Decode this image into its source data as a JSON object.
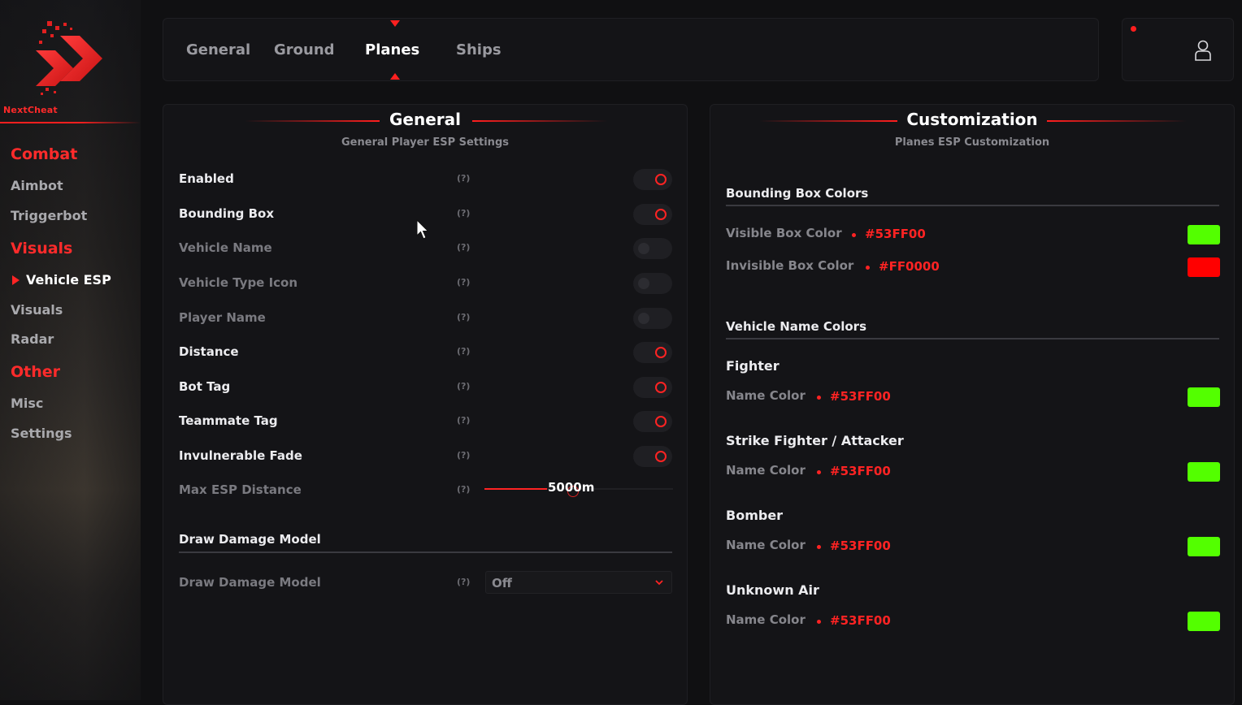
{
  "brand": {
    "name": "NextCheat",
    "accent_color": "#ff2323"
  },
  "sidebar": {
    "categories": [
      {
        "label": "Combat",
        "items": [
          "Aimbot",
          "Triggerbot"
        ]
      },
      {
        "label": "Visuals",
        "items": [
          "Vehicle ESP",
          "Visuals",
          "Radar"
        ]
      },
      {
        "label": "Other",
        "items": [
          "Misc",
          "Settings"
        ]
      }
    ],
    "active_item": "Vehicle ESP"
  },
  "tabs": {
    "items": [
      "General",
      "Ground",
      "Planes",
      "Ships"
    ],
    "active": "Planes"
  },
  "user": {
    "icon": "user-icon",
    "notification_icon": "notification-dot-icon"
  },
  "general_panel": {
    "title": "General",
    "subtitle": "General Player ESP Settings",
    "help_label": "(?)",
    "options": [
      {
        "label": "Enabled",
        "state": "on"
      },
      {
        "label": "Bounding Box",
        "state": "on"
      },
      {
        "label": "Vehicle Name",
        "state": "off"
      },
      {
        "label": "Vehicle Type Icon",
        "state": "off"
      },
      {
        "label": "Player Name",
        "state": "off"
      },
      {
        "label": "Distance",
        "state": "on"
      },
      {
        "label": "Bot Tag",
        "state": "on"
      },
      {
        "label": "Teammate Tag",
        "state": "on"
      },
      {
        "label": "Invulnerable Fade",
        "state": "on"
      }
    ],
    "max_distance": {
      "label": "Max ESP Distance",
      "value_text": "5000m",
      "fill_fraction": 0.33
    },
    "damage_section": {
      "title": "Draw Damage Model",
      "row_label": "Draw Damage Model",
      "selected": "Off"
    }
  },
  "custom_panel": {
    "title": "Customization",
    "subtitle": "Planes ESP Customization",
    "box_section": {
      "title": "Bounding Box Colors",
      "rows": [
        {
          "label": "Visible Box Color",
          "hex": "#53FF00",
          "color": "#53ff00"
        },
        {
          "label": "Invisible Box Color",
          "hex": "#FF0000",
          "color": "#ff0000"
        }
      ]
    },
    "name_section": {
      "title": "Vehicle Name Colors",
      "groups": [
        {
          "name": "Fighter",
          "row_label": "Name Color",
          "hex": "#53FF00",
          "color": "#53ff00"
        },
        {
          "name": "Strike Fighter / Attacker",
          "row_label": "Name Color",
          "hex": "#53FF00",
          "color": "#53ff00"
        },
        {
          "name": "Bomber",
          "row_label": "Name Color",
          "hex": "#53FF00",
          "color": "#53ff00"
        },
        {
          "name": "Unknown Air",
          "row_label": "Name Color",
          "hex": "#53FF00",
          "color": "#53ff00"
        }
      ]
    }
  }
}
